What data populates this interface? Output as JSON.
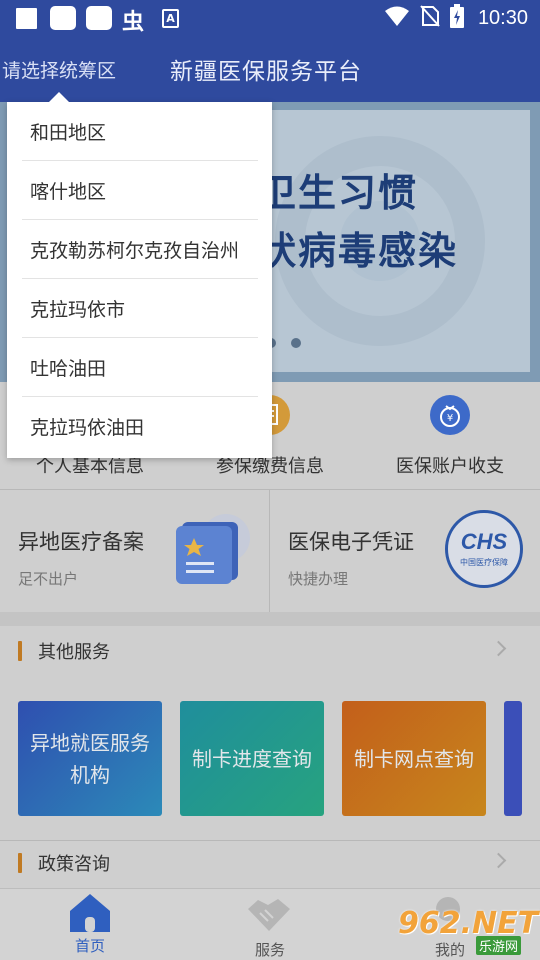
{
  "status_bar": {
    "time": "10:30",
    "left_glyph": "虫",
    "a_badge": "A",
    "icons": [
      "square-icon",
      "rounded-square-icon",
      "rounded-square-icon",
      "bug-icon",
      "a-badge-icon",
      "wifi-icon",
      "no-sim-icon",
      "battery-charging-icon"
    ]
  },
  "header": {
    "region_selector": "请选择统筹区",
    "title": "新疆医保服务平台"
  },
  "banner": {
    "line1": "卫生习惯",
    "line2": "状病毒感染"
  },
  "quick_services": [
    {
      "label": "个人基本信息",
      "icon": "person-icon",
      "color": "#d8b27a"
    },
    {
      "label": "参保缴费信息",
      "icon": "document-icon",
      "color": "#d39a3a"
    },
    {
      "label": "医保账户收支",
      "icon": "money-bag-icon",
      "color": "#3d6ac9"
    }
  ],
  "features": [
    {
      "title": "异地医疗备案",
      "subtitle": "足不出户",
      "icon": "star-card-icon"
    },
    {
      "title": "医保电子凭证",
      "subtitle": "快捷办理",
      "icon": "chs-logo-icon",
      "logo_text": "CHS",
      "logo_subtext": "中国医疗保障"
    }
  ],
  "other_services": {
    "title": "其他服务",
    "tiles": [
      {
        "label": "异地就医服务机构"
      },
      {
        "label": "制卡进度查询"
      },
      {
        "label": "制卡网点查询"
      }
    ]
  },
  "policy": {
    "title": "政策咨询"
  },
  "bottom_nav": {
    "items": [
      {
        "label": "首页",
        "icon": "home-icon",
        "active": true
      },
      {
        "label": "服务",
        "icon": "handshake-icon",
        "active": false
      },
      {
        "label": "我的",
        "icon": "user-icon",
        "active": false
      }
    ],
    "active_color": "#2f5fbf"
  },
  "watermark": {
    "big": "962.NET",
    "small": "乐游网"
  },
  "region_dropdown": {
    "options": [
      "和田地区",
      "喀什地区",
      "克孜勒苏柯尔克孜自治州",
      "克拉玛依市",
      "吐哈油田",
      "克拉玛依油田"
    ]
  },
  "colors": {
    "header_bg": "#2f4a9e",
    "overlay_tint": "#cfcfcf",
    "section_accent": "#c07a23"
  }
}
